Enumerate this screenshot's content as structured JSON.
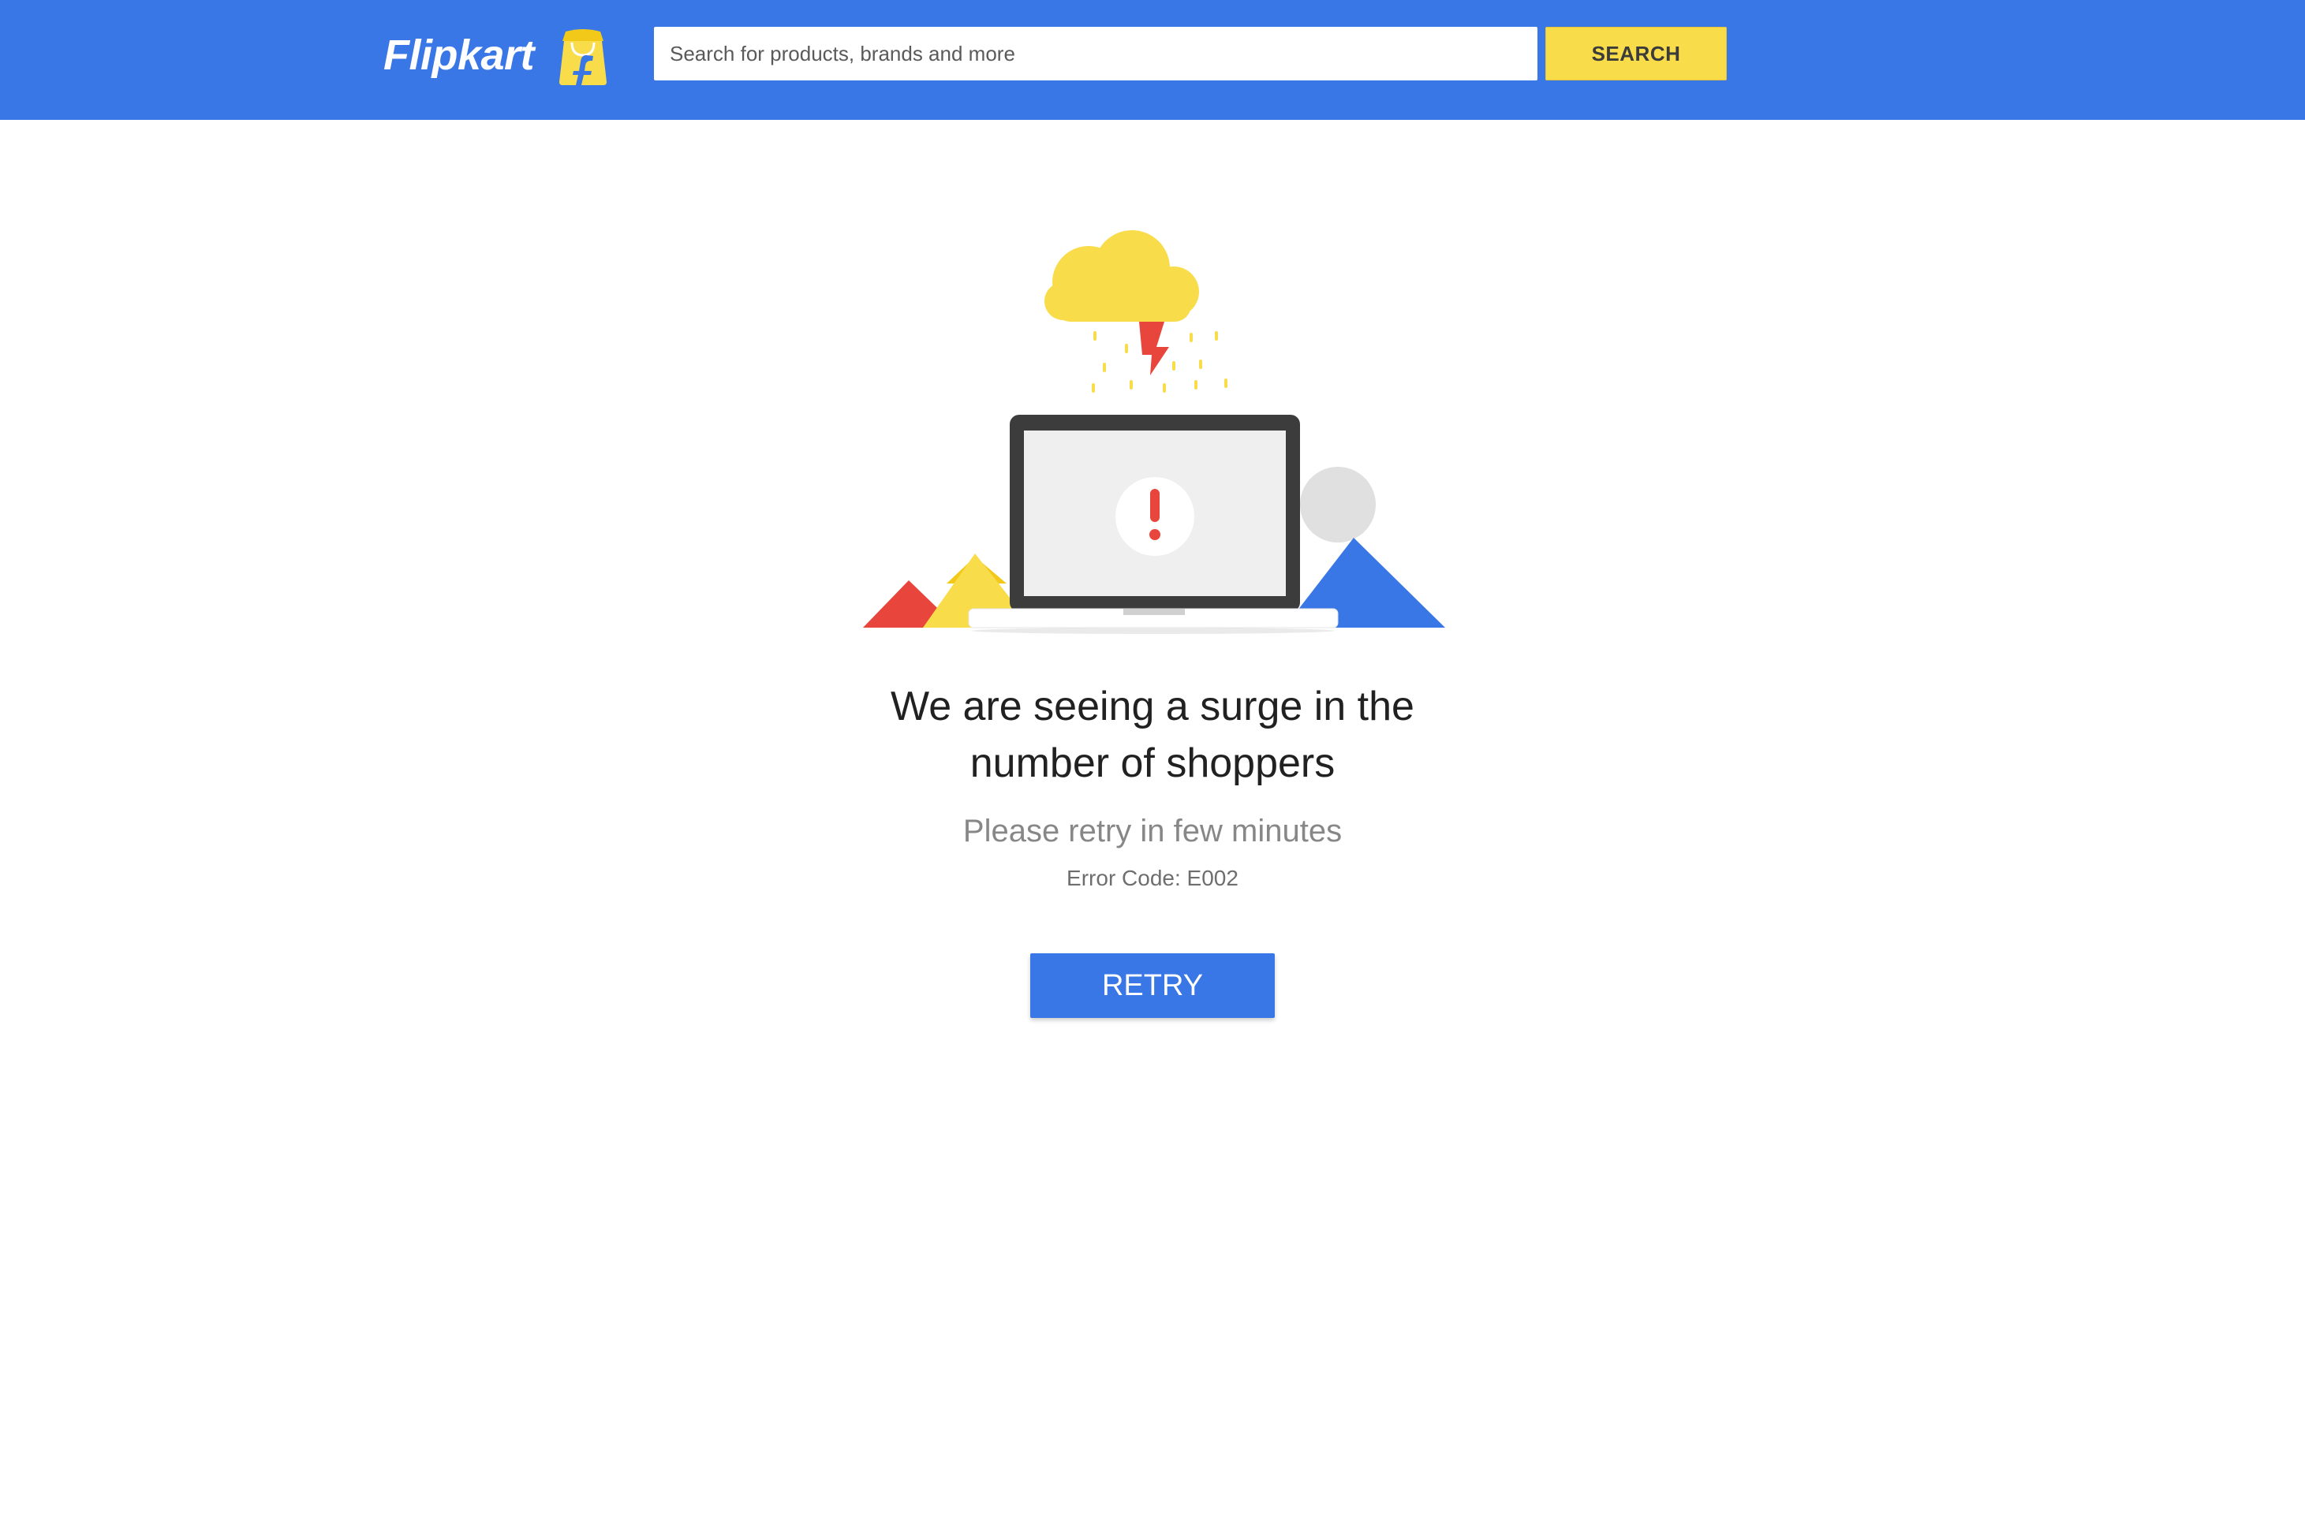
{
  "header": {
    "logo_text": "Flipkart",
    "search": {
      "placeholder": "Search for products, brands and more",
      "value": ""
    },
    "search_button_label": "SEARCH"
  },
  "error": {
    "headline_line1": "We are seeing a surge in the",
    "headline_line2": "number of shoppers",
    "subline": "Please retry in few minutes",
    "code_text": "Error Code: E002",
    "retry_label": "RETRY"
  },
  "icons": {
    "logo": "flipkart-shopping-bag-icon",
    "illustration": "laptop-error-illustration",
    "alert": "exclamation-icon",
    "weather": "storm-cloud-icon"
  },
  "colors": {
    "brand_blue": "#3a77e6",
    "brand_yellow": "#f9dc4a",
    "alert_red": "#e8453c"
  }
}
